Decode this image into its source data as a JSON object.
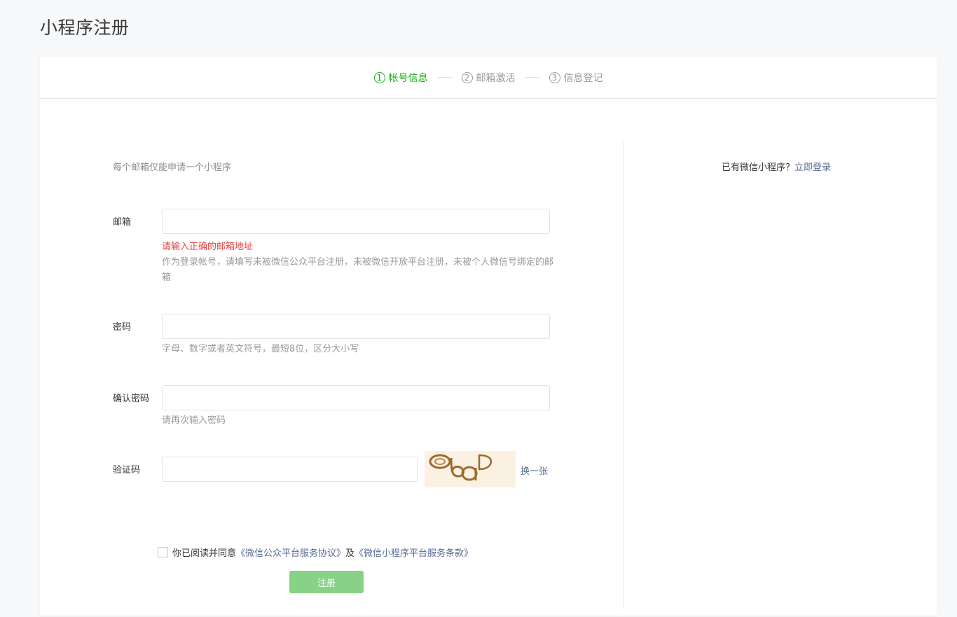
{
  "page": {
    "title": "小程序注册"
  },
  "steps": [
    {
      "num": "1",
      "label": "帐号信息",
      "active": true
    },
    {
      "num": "2",
      "label": "邮箱激活",
      "active": false
    },
    {
      "num": "3",
      "label": "信息登记",
      "active": false
    }
  ],
  "notice": "每个邮箱仅能申请一个小程序",
  "login_tip": {
    "text": "已有微信小程序？",
    "link": "立即登录"
  },
  "form": {
    "email": {
      "label": "邮箱",
      "value": "",
      "error": "请输入正确的邮箱地址",
      "hint": "作为登录帐号，请填写未被微信公众平台注册，未被微信开放平台注册，未被个人微信号绑定的邮箱"
    },
    "password": {
      "label": "密码",
      "value": "",
      "hint": "字母、数字或者英文符号，最短8位，区分大小写"
    },
    "confirm": {
      "label": "确认密码",
      "value": "",
      "hint": "请再次输入密码"
    },
    "captcha": {
      "label": "验证码",
      "value": "",
      "image_text": "ObaD",
      "refresh": "换一张"
    }
  },
  "agreement": {
    "prefix": "你已阅读并同意",
    "link1": "《微信公众平台服务协议》",
    "middle": "及",
    "link2": "《微信小程序平台服务条款》",
    "checked": false
  },
  "submit_label": "注册",
  "colors": {
    "accent": "#1aad19",
    "link": "#576b95",
    "error": "#e64340",
    "button_disabled": "#87d286"
  }
}
